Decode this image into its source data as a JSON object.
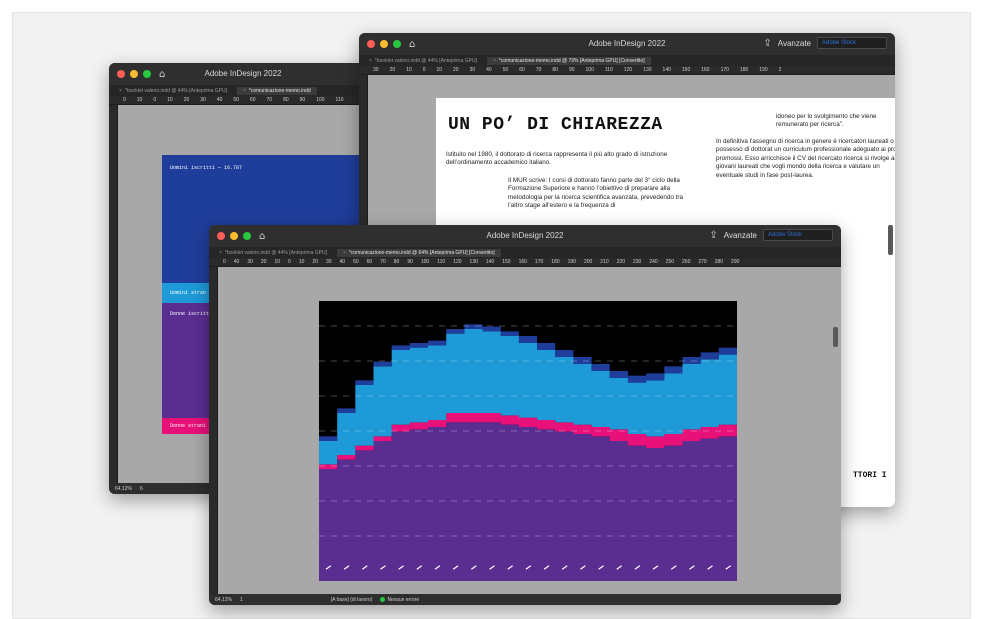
{
  "windows": {
    "back_left": {
      "app_title": "Adobe InDesign 2022",
      "tabs": [
        "*booklet valerio.indd @ 44% [Anteprima GPU]",
        "*comunicazione-memo.indd"
      ],
      "ruler": [
        "0",
        "10",
        "0",
        "10",
        "20",
        "30",
        "40",
        "50",
        "60",
        "70",
        "80",
        "90",
        "100",
        "110"
      ],
      "labels": {
        "men_enrolled": "Uomini iscritti — 16.787",
        "men_foreign": "Uomini stran",
        "women_enrolled": "Donne iscritt",
        "women_foreign": "Donne strani"
      },
      "status": {
        "zoom": "64,12%",
        "page": "6"
      }
    },
    "back_right": {
      "app_title": "Adobe InDesign 2022",
      "toolbar": {
        "advanced": "Avanzate",
        "stock_placeholder": "Adobe Stock"
      },
      "tabs": [
        "*booklet valerio.indd @ 44% [Anteprima GPU]",
        "*comunicazione-memo.indd @ 79% [Anteprima GPU] [Convertito]"
      ],
      "ruler": [
        "30",
        "20",
        "10",
        "0",
        "10",
        "20",
        "30",
        "40",
        "50",
        "60",
        "70",
        "80",
        "90",
        "100",
        "110",
        "120",
        "130",
        "140",
        "150",
        "160",
        "170",
        "180",
        "190",
        "2"
      ],
      "document": {
        "heading": "UN PO’ DI CHIAREZZA",
        "para_left_1": "Istituito nel 1980, il dottorato di ricerca rappresenta il più alto grado di istruzione dell’ordinamento accademico italiano.",
        "para_left_2": "Il MUR scrive: I corsi di dottorato fanno parte del 3° ciclo della Formazione Superiore e hanno l’obiettivo di preparare alla metodologia per la ricerca scientifica avanzata, prevedendo tra l’altro stage all’estero e la frequenza di",
        "para_right_1": "idoneo per lo svolgimento che viene remunerato per ricerca”.",
        "para_right_2": "In definitiva l’assegno di ricerca in genere è ricercatori laureati o in possesso di dottorat un curriculum professionale adeguato ai pro promossi. Esso arricchisce il CV del ricercato ricerca si rivolge ai giovani laureati che vogli mondo della ricerca e valutare un eventuale studi in fase post-laurea.",
        "cut_text": "TTORI I"
      }
    },
    "front": {
      "app_title": "Adobe InDesign 2022",
      "toolbar": {
        "advanced": "Avanzate",
        "stock_placeholder": "Adobe Stock"
      },
      "tabs": [
        "*booklet valerio.indd @ 44% [Anteprima GPU]",
        "*comunicazione-memo.indd @ 64% [Anteprima GPU] [Convertito]"
      ],
      "ruler": [
        "0",
        "40",
        "30",
        "20",
        "10",
        "0",
        "10",
        "20",
        "30",
        "40",
        "50",
        "60",
        "70",
        "80",
        "90",
        "100",
        "110",
        "120",
        "130",
        "140",
        "150",
        "160",
        "170",
        "180",
        "190",
        "200",
        "210",
        "220",
        "230",
        "240",
        "250",
        "260",
        "270",
        "280",
        "290"
      ],
      "status": {
        "zoom": "64,12%",
        "page": "1",
        "layer": "[A base] (di lavoro)",
        "preflight": "Nessun errore"
      },
      "chart_data": {
        "type": "area",
        "stacked": true,
        "series": [
          {
            "color": "#5a2d91",
            "values": [
              48,
              52,
              56,
              60,
              64,
              65,
              66,
              68,
              68,
              68,
              67,
              66,
              65,
              64,
              63,
              62,
              60,
              58,
              57,
              58,
              60,
              61,
              62
            ]
          },
          {
            "color": "#e8117a",
            "values": [
              2,
              2,
              2,
              2,
              3,
              3,
              3,
              4,
              4,
              4,
              4,
              4,
              4,
              4,
              4,
              4,
              5,
              5,
              5,
              5,
              5,
              5,
              5
            ]
          },
          {
            "color": "#1e9ad8",
            "values": [
              10,
              18,
              26,
              30,
              32,
              32,
              32,
              34,
              36,
              35,
              34,
              32,
              30,
              28,
              26,
              24,
              22,
              22,
              24,
              26,
              28,
              29,
              30
            ]
          },
          {
            "color": "#1f3d9a",
            "values": [
              2,
              2,
              2,
              2,
              2,
              2,
              2,
              2,
              2,
              2,
              2,
              3,
              3,
              3,
              3,
              3,
              3,
              3,
              3,
              3,
              3,
              3,
              3
            ]
          }
        ],
        "ylim": [
          0,
          120
        ]
      }
    }
  }
}
